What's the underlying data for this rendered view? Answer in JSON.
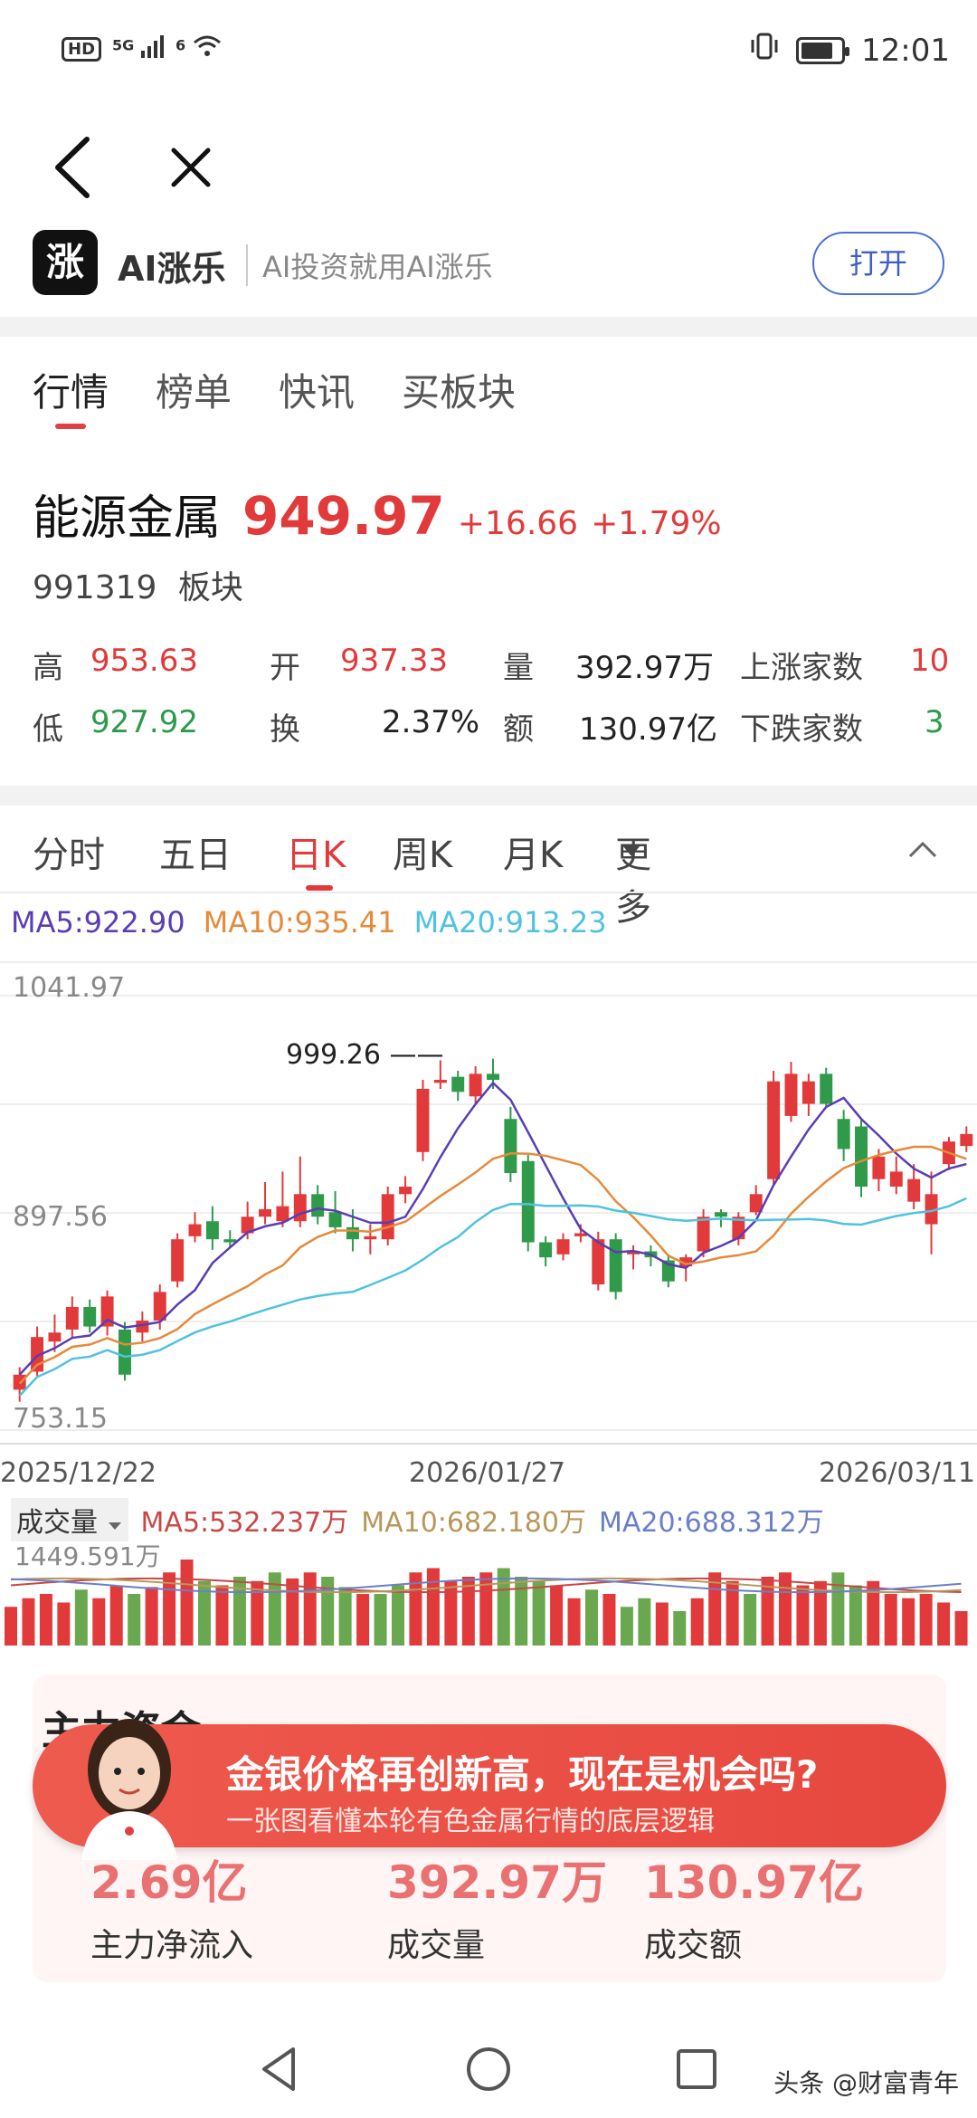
{
  "status_bar": {
    "network_hd": "HD",
    "signal_5g": "5G",
    "wifi_badge": "6",
    "time": "12:01",
    "battery_level": 0.8
  },
  "app_banner": {
    "logo_text": "涨",
    "name": "AI涨乐",
    "slogan": "AI投资就用AI涨乐",
    "open_label": "打开"
  },
  "tabs": [
    "行情",
    "榜单",
    "快讯",
    "买板块"
  ],
  "quote": {
    "name": "能源金属",
    "price": "949.97",
    "change": "+16.66",
    "change_pct": "+1.79%",
    "code": "991319",
    "type": "板块"
  },
  "stats": {
    "high_label": "高",
    "high": "953.63",
    "open_label": "开",
    "open": "937.33",
    "vol_label": "量",
    "vol": "392.97万",
    "up_label": "上涨家数",
    "up": "10",
    "low_label": "低",
    "low": "927.92",
    "turnover_label": "换",
    "turnover": "2.37%",
    "amount_label": "额",
    "amount": "130.97亿",
    "down_label": "下跌家数",
    "down": "3"
  },
  "kline_tabs": [
    "分时",
    "五日",
    "日K",
    "周K",
    "月K",
    "更多"
  ],
  "ma": {
    "ma5": "MA5:922.90",
    "ma10": "MA10:935.41",
    "ma20": "MA20:913.23"
  },
  "chart_data": {
    "type": "candlestick",
    "y_ticks": [
      "1041.97",
      "897.56",
      "753.15"
    ],
    "ylim": [
      753.15,
      1041.97
    ],
    "x_ticks": [
      "2025/12/22",
      "2026/01/27",
      "2026/03/11"
    ],
    "peak_label": "999.26",
    "candles": [
      [
        780,
        790,
        772,
        795
      ],
      [
        792,
        815,
        788,
        822
      ],
      [
        812,
        818,
        805,
        830
      ],
      [
        820,
        835,
        814,
        842
      ],
      [
        835,
        822,
        818,
        840
      ],
      [
        822,
        842,
        816,
        846
      ],
      [
        820,
        790,
        786,
        825
      ],
      [
        818,
        826,
        812,
        832
      ],
      [
        826,
        845,
        820,
        850
      ],
      [
        852,
        880,
        848,
        884
      ],
      [
        882,
        890,
        878,
        898
      ],
      [
        892,
        880,
        873,
        902
      ],
      [
        880,
        878,
        874,
        886
      ],
      [
        884,
        895,
        880,
        905
      ],
      [
        895,
        900,
        890,
        918
      ],
      [
        892,
        902,
        888,
        925
      ],
      [
        892,
        910,
        888,
        935
      ],
      [
        910,
        895,
        890,
        916
      ],
      [
        898,
        888,
        884,
        912
      ],
      [
        888,
        880,
        872,
        900
      ],
      [
        880,
        882,
        870,
        890
      ],
      [
        880,
        910,
        876,
        915
      ],
      [
        910,
        915,
        904,
        922
      ],
      [
        938,
        980,
        932,
        986
      ],
      [
        984,
        986,
        980,
        999
      ],
      [
        988,
        978,
        972,
        992
      ],
      [
        975,
        990,
        970,
        995
      ],
      [
        990,
        986,
        980,
        1000
      ],
      [
        960,
        924,
        918,
        968
      ],
      [
        932,
        878,
        872,
        936
      ],
      [
        878,
        868,
        862,
        882
      ],
      [
        870,
        880,
        866,
        884
      ],
      [
        882,
        884,
        878,
        890
      ],
      [
        850,
        880,
        846,
        885
      ],
      [
        880,
        845,
        840,
        884
      ],
      [
        870,
        872,
        860,
        876
      ],
      [
        872,
        868,
        862,
        876
      ],
      [
        866,
        852,
        848,
        870
      ],
      [
        862,
        868,
        852,
        870
      ],
      [
        872,
        895,
        868,
        900
      ],
      [
        898,
        895,
        888,
        900
      ],
      [
        880,
        895,
        876,
        898
      ],
      [
        898,
        910,
        896,
        916
      ],
      [
        920,
        985,
        916,
        992
      ],
      [
        962,
        990,
        958,
        998
      ],
      [
        970,
        985,
        962,
        990
      ],
      [
        990,
        970,
        968,
        994
      ],
      [
        960,
        940,
        932,
        966
      ],
      [
        955,
        915,
        908,
        960
      ],
      [
        920,
        935,
        912,
        940
      ],
      [
        915,
        925,
        910,
        935
      ],
      [
        905,
        920,
        900,
        930
      ],
      [
        890,
        910,
        870,
        925
      ],
      [
        930,
        945,
        926,
        948
      ],
      [
        942,
        950,
        938,
        955
      ]
    ]
  },
  "volume": {
    "label": "成交量",
    "ma5": "MA5:532.237万",
    "ma10": "MA10:682.180万",
    "ma20": "MA20:688.312万",
    "max": "1449.591万",
    "bars": [
      [
        0.45,
        "r"
      ],
      [
        0.55,
        "r"
      ],
      [
        0.6,
        "r"
      ],
      [
        0.5,
        "r"
      ],
      [
        0.65,
        "g"
      ],
      [
        0.55,
        "r"
      ],
      [
        0.7,
        "r"
      ],
      [
        0.6,
        "g"
      ],
      [
        0.68,
        "r"
      ],
      [
        0.85,
        "r"
      ],
      [
        1.0,
        "r"
      ],
      [
        0.75,
        "g"
      ],
      [
        0.7,
        "r"
      ],
      [
        0.8,
        "g"
      ],
      [
        0.75,
        "r"
      ],
      [
        0.85,
        "g"
      ],
      [
        0.78,
        "r"
      ],
      [
        0.85,
        "r"
      ],
      [
        0.8,
        "g"
      ],
      [
        0.68,
        "g"
      ],
      [
        0.6,
        "r"
      ],
      [
        0.6,
        "g"
      ],
      [
        0.7,
        "g"
      ],
      [
        0.85,
        "r"
      ],
      [
        0.9,
        "r"
      ],
      [
        0.75,
        "r"
      ],
      [
        0.8,
        "r"
      ],
      [
        0.85,
        "r"
      ],
      [
        0.9,
        "g"
      ],
      [
        0.8,
        "g"
      ],
      [
        0.75,
        "g"
      ],
      [
        0.7,
        "r"
      ],
      [
        0.55,
        "r"
      ],
      [
        0.65,
        "g"
      ],
      [
        0.6,
        "r"
      ],
      [
        0.45,
        "g"
      ],
      [
        0.55,
        "g"
      ],
      [
        0.5,
        "r"
      ],
      [
        0.4,
        "g"
      ],
      [
        0.55,
        "r"
      ],
      [
        0.85,
        "r"
      ],
      [
        0.75,
        "r"
      ],
      [
        0.6,
        "g"
      ],
      [
        0.8,
        "r"
      ],
      [
        0.85,
        "r"
      ],
      [
        0.7,
        "r"
      ],
      [
        0.75,
        "r"
      ],
      [
        0.85,
        "g"
      ],
      [
        0.7,
        "g"
      ],
      [
        0.75,
        "r"
      ],
      [
        0.6,
        "r"
      ],
      [
        0.55,
        "r"
      ],
      [
        0.6,
        "r"
      ],
      [
        0.5,
        "r"
      ],
      [
        0.4,
        "r"
      ]
    ]
  },
  "main_flow": {
    "title": "主力资金",
    "items": [
      {
        "value": "2.69亿",
        "label": "主力净流入"
      },
      {
        "value": "392.97万",
        "label": "成交量"
      },
      {
        "value": "130.97亿",
        "label": "成交额"
      }
    ]
  },
  "promo": {
    "title": "金银价格再创新高，现在是机会吗?",
    "subtitle": "一张图看懂本轮有色金属行情的底层逻辑"
  },
  "watermark": "头条 @财富青年",
  "colors": {
    "up": "#e23a3a",
    "down": "#2e9a4a",
    "ma5": "#5a3db5",
    "ma10": "#e58a3a",
    "ma20": "#4ec2e0"
  }
}
